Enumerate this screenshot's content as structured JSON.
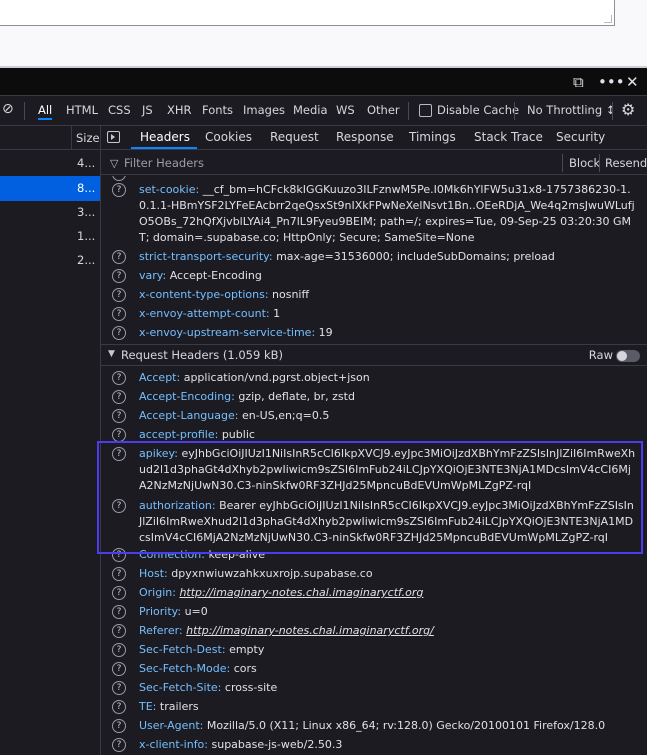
{
  "devtools": {
    "topbar": {
      "dock_icon": "dock-icon",
      "more_icon": "more-icon",
      "close_icon": "close-icon"
    },
    "filter_bar": {
      "block_icon": "block-icon",
      "types": [
        "All",
        "HTML",
        "CSS",
        "JS",
        "XHR",
        "Fonts",
        "Images",
        "Media",
        "WS",
        "Other"
      ],
      "active_type": "All",
      "disable_cache_label": "Disable Cache",
      "throttling_label": "No Throttling ↕",
      "settings_icon": "gear-icon"
    },
    "request_list": {
      "size_header": "Size",
      "rows": [
        {
          "size": "4..."
        },
        {
          "size": "8...",
          "selected": true
        },
        {
          "size": "3..."
        },
        {
          "size": "1..."
        },
        {
          "size": "2..."
        }
      ]
    },
    "details": {
      "panel_icon": "panel-toggle-icon",
      "tabs": [
        "Headers",
        "Cookies",
        "Request",
        "Response",
        "Timings",
        "Stack Trace",
        "Security"
      ],
      "active_tab": "Headers",
      "filter_placeholder": "Filter Headers",
      "block_label": "Block",
      "resend_label": "Resend",
      "response_headers": [
        {
          "name": "set-cookie:",
          "value": "__cf_bm=hCFck8kIGGKuuzo3ILFznwM5Pe.I0Mk6hYlFW5u31x8-1757386230-1.0.1.1-HBmYSF2LYFeEAcbrr2qeQsxSt9nIXkFPwNeXelNsvt1Bn..OEeRDjA_We4q2msJwuWLufjO5OBs_72hQfXjvblLYAi4_Pn7lL9Fyeu9BEIM; path=/; expires=Tue, 09-Sep-25 03:20:30 GMT; domain=.supabase.co; HttpOnly; Secure; SameSite=None"
        },
        {
          "name": "strict-transport-security:",
          "value": "max-age=31536000; includeSubDomains; preload"
        },
        {
          "name": "vary:",
          "value": "Accept-Encoding"
        },
        {
          "name": "x-content-type-options:",
          "value": "nosniff"
        },
        {
          "name": "x-envoy-attempt-count:",
          "value": "1"
        },
        {
          "name": "x-envoy-upstream-service-time:",
          "value": "19"
        }
      ],
      "request_section_title": "Request Headers (1.059 kB)",
      "raw_label": "Raw",
      "request_headers": [
        {
          "name": "Accept:",
          "value": "application/vnd.pgrst.object+json"
        },
        {
          "name": "Accept-Encoding:",
          "value": "gzip, deflate, br, zstd"
        },
        {
          "name": "Accept-Language:",
          "value": "en-US,en;q=0.5"
        },
        {
          "name": "accept-profile:",
          "value": "public"
        },
        {
          "name": "apikey:",
          "value": "eyJhbGciOiJIUzI1NiIsInR5cCI6IkpXVCJ9.eyJpc3MiOiJzdXBhYmFzZSIsInJlZiI6ImRweXhud2l1d3phaGt4dXhyb2pwIiwicm9sZSI6ImFub24iLCJpYXQiOjE3NTE3NjA1MDcsImV4cCI6MjA2NzMzNjUwN30.C3-ninSkfw0RF3ZHJd25MpncuBdEVUmWpMLZgPZ-rqI"
        },
        {
          "name": "authorization:",
          "value": "Bearer eyJhbGciOiJIUzI1NiIsInR5cCI6IkpXVCJ9.eyJpc3MiOiJzdXBhYmFzZSIsInJlZiI6ImRweXhud2l1d3phaGt4dXhyb2pwIiwicm9sZSI6ImFub24iLCJpYXQiOjE3NTE3NjA1MDcsImV4cCI6MjA2NzMzNjUwN30.C3-ninSkfw0RF3ZHJd25MpncuBdEVUmWpMLZgPZ-rqI"
        },
        {
          "name": "Connection:",
          "value": "keep-alive"
        },
        {
          "name": "Host:",
          "value": "dpyxnwiuwzahkxuxrojp.supabase.co"
        },
        {
          "name": "Origin:",
          "value": "http://imaginary-notes.chal.imaginaryctf.org"
        },
        {
          "name": "Priority:",
          "value": "u=0"
        },
        {
          "name": "Referer:",
          "value": "http://imaginary-notes.chal.imaginaryctf.org/"
        },
        {
          "name": "Sec-Fetch-Dest:",
          "value": "empty"
        },
        {
          "name": "Sec-Fetch-Mode:",
          "value": "cors"
        },
        {
          "name": "Sec-Fetch-Site:",
          "value": "cross-site"
        },
        {
          "name": "TE:",
          "value": "trailers"
        },
        {
          "name": "User-Agent:",
          "value": "Mozilla/5.0 (X11; Linux x86_64; rv:128.0) Gecko/20100101 Firefox/128.0"
        },
        {
          "name": "x-client-info:",
          "value": "supabase-js-web/2.50.3"
        }
      ],
      "help_icon": "question-icon",
      "highlight_color": "#4b3cf0"
    }
  }
}
